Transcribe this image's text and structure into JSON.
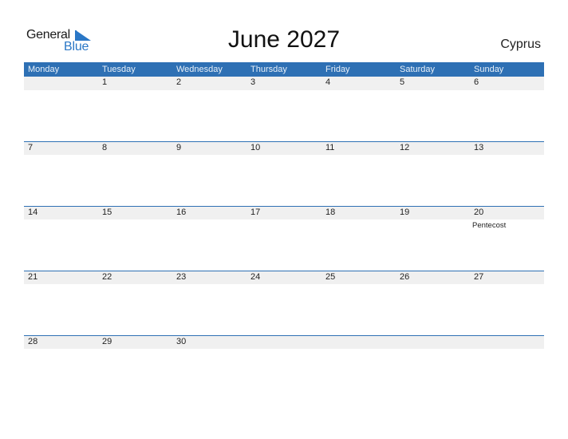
{
  "logo": {
    "part1": "General",
    "part2": "Blue"
  },
  "title": "June 2027",
  "country": "Cyprus",
  "colors": {
    "header_bg": "#2e70b4",
    "accent": "#2a77c6",
    "strip_bg": "#f0f0f0"
  },
  "weekdays": [
    "Monday",
    "Tuesday",
    "Wednesday",
    "Thursday",
    "Friday",
    "Saturday",
    "Sunday"
  ],
  "weeks": [
    {
      "days": [
        "",
        "1",
        "2",
        "3",
        "4",
        "5",
        "6"
      ],
      "events": [
        "",
        "",
        "",
        "",
        "",
        "",
        ""
      ]
    },
    {
      "days": [
        "7",
        "8",
        "9",
        "10",
        "11",
        "12",
        "13"
      ],
      "events": [
        "",
        "",
        "",
        "",
        "",
        "",
        ""
      ]
    },
    {
      "days": [
        "14",
        "15",
        "16",
        "17",
        "18",
        "19",
        "20"
      ],
      "events": [
        "",
        "",
        "",
        "",
        "",
        "",
        "Pentecost"
      ]
    },
    {
      "days": [
        "21",
        "22",
        "23",
        "24",
        "25",
        "26",
        "27"
      ],
      "events": [
        "",
        "",
        "",
        "",
        "",
        "",
        ""
      ]
    },
    {
      "days": [
        "28",
        "29",
        "30",
        "",
        "",
        "",
        ""
      ],
      "events": [
        "",
        "",
        "",
        "",
        "",
        "",
        ""
      ]
    }
  ]
}
